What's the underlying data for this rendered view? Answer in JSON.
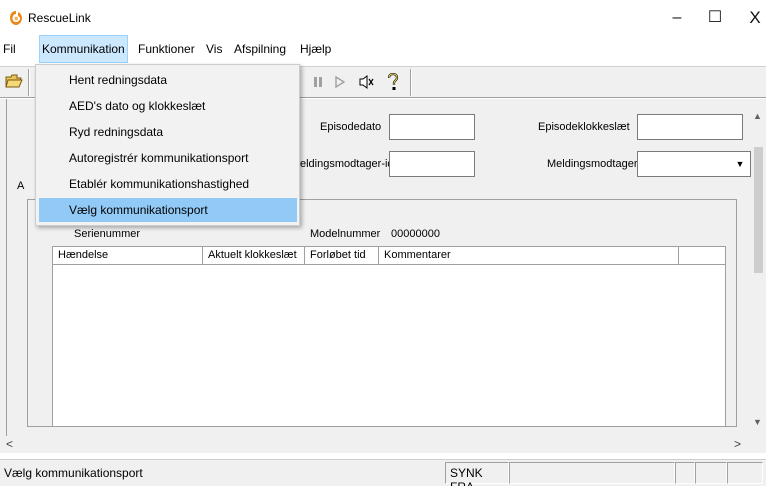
{
  "window": {
    "title": "RescueLink",
    "minimize_glyph": "–",
    "maximize_glyph": "☐",
    "close_glyph": "X"
  },
  "menubar": {
    "items": [
      {
        "label": "Fil"
      },
      {
        "label": "Kommunikation"
      },
      {
        "label": "Funktioner"
      },
      {
        "label": "Vis"
      },
      {
        "label": "Afspilning"
      },
      {
        "label": "Hjælp"
      }
    ]
  },
  "toolbar": {
    "icons": [
      "open-folder-icon",
      "pause-icon",
      "play-icon",
      "speaker-icon",
      "help-icon"
    ]
  },
  "form": {
    "episodedato_label": "Episodedato",
    "episodeklokkeslaet_label": "Episodeklokkeslæt",
    "meldingsmodtager_id_label": "eldingsmodtager-id",
    "meldingsmodtager_label": "Meldingsmodtager",
    "tab_stub": "A"
  },
  "device": {
    "serienummer_label": "Serienummer",
    "modelnummer_label": "Modelnummer",
    "modelnummer_value": "00000000"
  },
  "table": {
    "columns": [
      "Hændelse",
      "Aktuelt klokkeslæt",
      "Forløbet tid",
      "Kommentarer"
    ]
  },
  "dropdown": {
    "items": [
      {
        "label": "Hent redningsdata"
      },
      {
        "label": "AED's dato og klokkeslæt"
      },
      {
        "label": "Ryd redningsdata"
      },
      {
        "label": "Autoregistrér kommunikationsport"
      },
      {
        "label": "Etablér kommunikationshastighed"
      },
      {
        "label": "Vælg kommunikationsport"
      }
    ],
    "highlighted_index": 5
  },
  "statusbar": {
    "text": "Vælg kommunikationsport",
    "pane_label": "SYNK FRA"
  },
  "colors": {
    "menu_active": "#cce8ff",
    "dropdown_highlight": "#91c9f7",
    "app_icon": "#e8891c"
  }
}
